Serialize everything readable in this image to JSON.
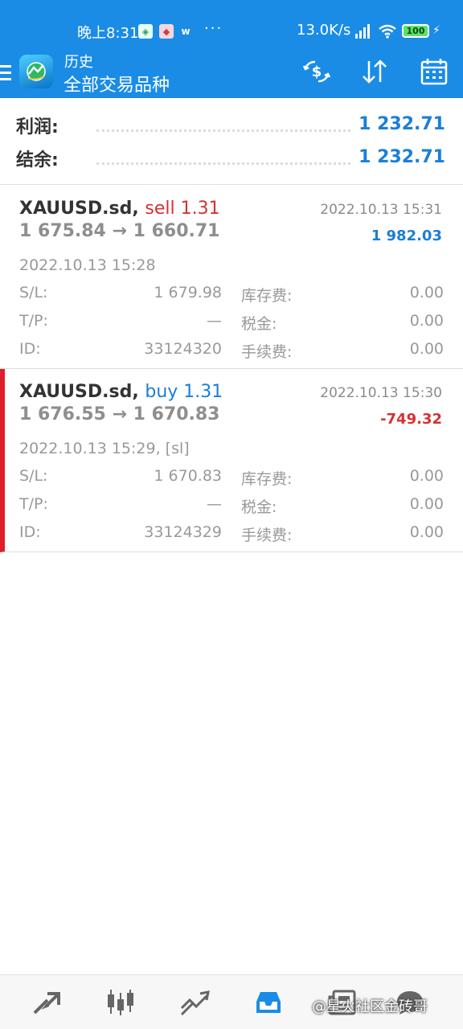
{
  "status_bar": {
    "time": "晚上8:31",
    "network_speed": "13.0K/s",
    "battery": "100"
  },
  "toolbar": {
    "title": "历史",
    "subtitle": "全部交易品种"
  },
  "summary": {
    "profit_label": "利润:",
    "profit_value": "1 232.71",
    "balance_label": "结余:",
    "balance_value": "1 232.71"
  },
  "deals": [
    {
      "symbol": "XAUUSD.sd,",
      "side": "sell 1.31",
      "close_time": "2022.10.13 15:31",
      "prices": "1 675.84 → 1 660.71",
      "profit": "1 982.03",
      "open_time": "2022.10.13 15:28",
      "sl_label": "S/L:",
      "sl_value": "1 679.98",
      "tp_label": "T/P:",
      "tp_value": "—",
      "id_label": "ID:",
      "id_value": "33124320",
      "swap_label": "库存费:",
      "swap_value": "0.00",
      "tax_label": "税金:",
      "tax_value": "0.00",
      "fee_label": "手续费:",
      "fee_value": "0.00"
    },
    {
      "symbol": "XAUUSD.sd,",
      "side": "buy 1.31",
      "close_time": "2022.10.13 15:30",
      "prices": "1 676.55 → 1 670.83",
      "profit": "-749.32",
      "open_time": "2022.10.13 15:29, [sl]",
      "sl_label": "S/L:",
      "sl_value": "1 670.83",
      "tp_label": "T/P:",
      "tp_value": "—",
      "id_label": "ID:",
      "id_value": "33124329",
      "swap_label": "库存费:",
      "swap_value": "0.00",
      "tax_label": "税金:",
      "tax_value": "0.00",
      "fee_label": "手续费:",
      "fee_value": "0.00"
    }
  ],
  "watermark": "@星火社区金砖哥",
  "icons": {
    "nav": [
      "quotes-icon",
      "chart-icon",
      "trade-icon",
      "history-icon",
      "news-icon",
      "messages-icon"
    ],
    "toolbar": [
      "currency-exchange-icon",
      "sort-icon",
      "calendar-icon"
    ]
  },
  "colors": {
    "primary": "#1a8ce6",
    "profit_positive": "#1a7fd6",
    "profit_negative": "#d63131",
    "selected_marker": "#e01e2a"
  }
}
